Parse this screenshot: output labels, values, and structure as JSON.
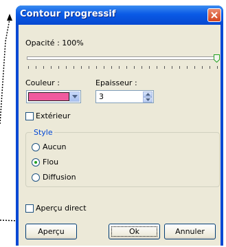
{
  "dialog": {
    "title": "Contour progressif",
    "opacity_label": "Opacité : 100%",
    "opacity_value": 100,
    "color_label": "Couleur :",
    "color_value": "#f05a9e",
    "thickness_label": "Epaisseur :",
    "thickness_value": "3",
    "outside_label": "Extérieur",
    "outside_checked": false,
    "style": {
      "title": "Style",
      "options": [
        "Aucun",
        "Flou",
        "Diffusion"
      ],
      "selected": "Flou"
    },
    "preview_label": "Aperçu direct",
    "preview_checked": false,
    "buttons": {
      "preview": "Aperçu",
      "ok": "Ok",
      "cancel": "Annuler"
    }
  }
}
